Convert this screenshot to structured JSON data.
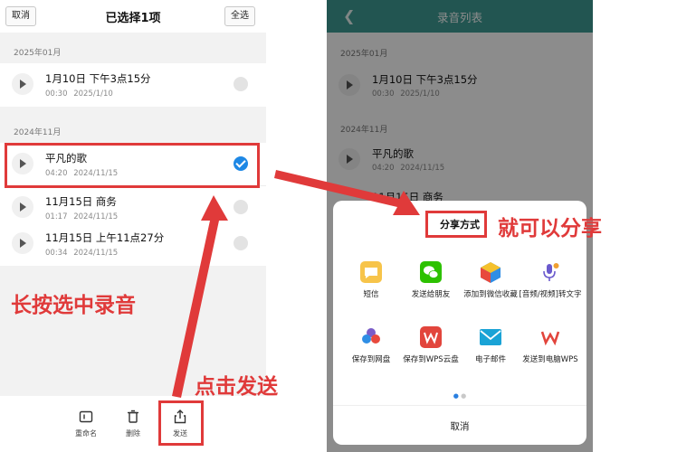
{
  "left": {
    "topbar": {
      "cancel": "取消",
      "title": "已选择1项",
      "select_all": "全选"
    },
    "sections": [
      {
        "header": "2025年01月",
        "items": [
          {
            "title": "1月10日 下午3点15分",
            "duration": "00:30",
            "date": "2025/1/10",
            "selected": false
          }
        ]
      },
      {
        "header": "2024年11月",
        "items": [
          {
            "title": "平凡的歌",
            "duration": "04:20",
            "date": "2024/11/15",
            "selected": true
          },
          {
            "title": "11月15日 商务",
            "duration": "01:17",
            "date": "2024/11/15",
            "selected": false
          },
          {
            "title": "11月15日 上午11点27分",
            "duration": "00:34",
            "date": "2024/11/15",
            "selected": false
          }
        ]
      }
    ],
    "bottombar": {
      "rename": "重命名",
      "delete": "删除",
      "send": "发送"
    }
  },
  "right": {
    "title": "录音列表",
    "back_icon": "chevron-left-icon",
    "sections": [
      {
        "header": "2025年01月",
        "items": [
          {
            "title": "1月10日 下午3点15分",
            "duration": "00:30",
            "date": "2025/1/10"
          }
        ]
      },
      {
        "header": "2024年11月",
        "items": [
          {
            "title": "平凡的歌",
            "duration": "04:20",
            "date": "2024/11/15"
          },
          {
            "title": "11月15日 商务",
            "duration": "",
            "date": ""
          }
        ]
      }
    ],
    "share_sheet": {
      "title": "分享方式",
      "apps": [
        {
          "label": "短信",
          "icon": "sms-icon",
          "color": "#f7c44a"
        },
        {
          "label": "发送给朋友",
          "icon": "wechat-icon",
          "color": "#2dc100"
        },
        {
          "label": "添加到微信收藏",
          "icon": "wechat-favorites-icon",
          "color": "#f0a030"
        },
        {
          "label": "[音频/视频]转文字",
          "icon": "audio-to-text-icon",
          "color": "#6a5acd"
        },
        {
          "label": "保存到网盘",
          "icon": "cloud-drive-icon",
          "color": "#7a5cc8"
        },
        {
          "label": "保存到WPS云盘",
          "icon": "wps-cloud-icon",
          "color": "#e2453c"
        },
        {
          "label": "电子邮件",
          "icon": "email-icon",
          "color": "#1aa3d6"
        },
        {
          "label": "发送到电脑WPS",
          "icon": "wps-icon",
          "color": "#e2453c"
        }
      ],
      "cancel": "取消"
    }
  },
  "annotations": {
    "long_press": "长按选中录音",
    "tap_send": "点击发送",
    "can_share": "就可以分享"
  },
  "colors": {
    "accent_red": "#e03a3a",
    "teal": "#3f9b94",
    "check_blue": "#1e88e5"
  }
}
